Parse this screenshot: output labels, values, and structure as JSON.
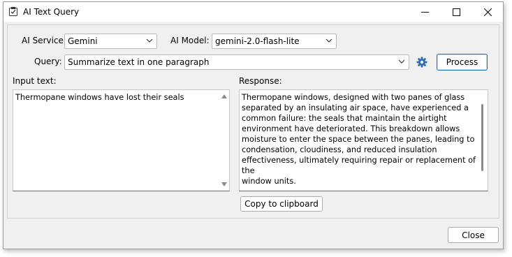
{
  "window": {
    "title": "AI Text Query"
  },
  "service": {
    "label": "AI Service:",
    "value": "Gemini"
  },
  "model": {
    "label": "AI Model:",
    "value": "gemini-2.0-flash-lite"
  },
  "query": {
    "label": "Query:",
    "value": "Summarize text in one paragraph"
  },
  "buttons": {
    "process": "Process",
    "copy": "Copy to clipboard",
    "close": "Close"
  },
  "input": {
    "label": "Input text:",
    "text": "Thermopane windows have lost their seals"
  },
  "response": {
    "label": "Response:",
    "text": "Thermopane windows, designed with two panes of glass\nseparated by an insulating air space, have experienced a\ncommon failure: the seals that maintain the airtight\nenvironment have deteriorated. This breakdown allows\nmoisture to enter the space between the panes, leading to\ncondensation, cloudiness, and reduced insulation\neffectiveness, ultimately requiring repair or replacement of the\nwindow units."
  },
  "icons": [
    "app-icon",
    "minimize-icon",
    "maximize-icon",
    "close-icon",
    "settings-gear-icon",
    "chevron-down-icon"
  ],
  "colors": {
    "gear": "#2f6db5",
    "default_button_border": "#1f6fbf"
  }
}
